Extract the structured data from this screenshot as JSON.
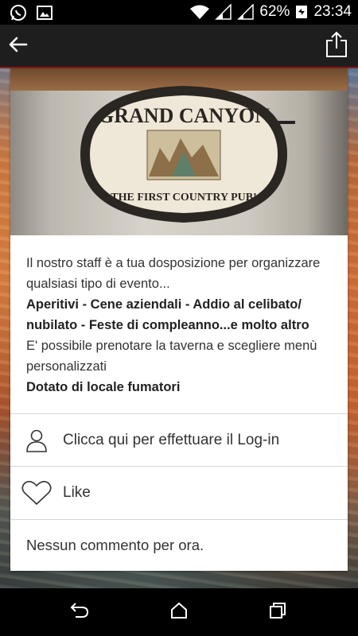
{
  "status_bar": {
    "battery": "62%",
    "time": "23:34"
  },
  "sign": {
    "line1": "GRAND CANYON",
    "line2": "THE FIRST COUNTRY PUB!"
  },
  "description": {
    "intro": "Il nostro staff è a tua dosposizione per organizzare qualsiasi tipo di evento...",
    "events": "Aperitivi - Cene aziendali - Addio al celibato/ nubilato - Feste di compleanno...e molto altro",
    "booking": "E' possibile prenotare la taverna e scegliere menù personalizzati",
    "smoking": "Dotato di locale fumatori"
  },
  "actions": {
    "login_label": "Clicca qui per effettuare il Log-in",
    "like_label": "Like",
    "comments_label": "Nessun commento per ora."
  },
  "icons": {
    "back": "arrow-left-icon",
    "share": "share-icon",
    "user": "user-icon",
    "heart": "heart-icon"
  },
  "colors": {
    "app_bar": "#1e1e1e",
    "accent_line": "#8a1a1a"
  }
}
